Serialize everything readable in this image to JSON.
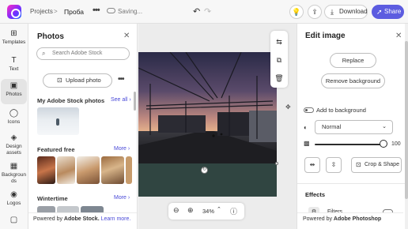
{
  "topbar": {
    "projects": "Projects",
    "separator": ">",
    "project_name": "Проба",
    "more": "•••",
    "saving": "Saving...",
    "undo": "↶",
    "redo": "↷",
    "lightbulb": "💡",
    "share_icon": "⇪",
    "download_icon": "⤓",
    "download_label": "Download",
    "share_label": "Share",
    "share_btn_icon": "➚"
  },
  "rail": [
    {
      "icon": "⊞",
      "label": "Templates",
      "name": "rail-templates"
    },
    {
      "icon": "T",
      "label": "Text",
      "name": "rail-text"
    },
    {
      "icon": "▣",
      "label": "Photos",
      "name": "rail-photos",
      "active": true
    },
    {
      "icon": "◯",
      "label": "Icons",
      "name": "rail-icons"
    },
    {
      "icon": "◈",
      "label": "Design assets",
      "name": "rail-design-assets"
    },
    {
      "icon": "▦",
      "label": "Backgrounds",
      "name": "rail-backgrounds"
    },
    {
      "icon": "◉",
      "label": "Logos",
      "name": "rail-logos"
    },
    {
      "icon": "▢",
      "label": "",
      "name": "rail-more"
    }
  ],
  "photos_panel": {
    "title": "Photos",
    "close": "✕",
    "search_icon": "⌕",
    "search_placeholder": "Search Adobe Stock",
    "upload_icon": "⊡",
    "upload_label": "Upload photo",
    "more": "•••",
    "stock_title": "My Adobe Stock photos",
    "see_all": "See all ›",
    "featured_title": "Featured free",
    "featured_more": "More ›",
    "winter_title": "Wintertime",
    "winter_more": "More ›",
    "footer_prefix": "Powered by ",
    "footer_brand": "Adobe Stock.",
    "footer_link": " Learn more."
  },
  "canvas": {
    "tools": [
      "⇆",
      "⧉",
      "🗑"
    ],
    "side_handle": "✥",
    "resize_handle": "↻",
    "zoom_out": "⊖",
    "zoom_in": "⊕",
    "zoom_value": "34%",
    "zoom_chevron": "⌃",
    "info": "ⓘ",
    "box_color": "#304541"
  },
  "edit_panel": {
    "title": "Edit image",
    "close": "✕",
    "replace": "Replace",
    "remove_bg": "Remove background",
    "add_to_bg": "Add to background",
    "blend_icon": "◐",
    "blend_value": "Normal",
    "blend_chevron": "⌄",
    "opacity_icon": "▩",
    "opacity_value": "100",
    "opacity_level": 1.0,
    "flip_h": "⇹",
    "flip_v": "⇳",
    "crop_icon": "⊡",
    "crop_label": "Crop & Shape",
    "effects": "Effects",
    "filters_icon": "⚙",
    "filters": "Filters",
    "footer_prefix": "Powered by ",
    "footer_brand": "Adobe Photoshop"
  },
  "colors": {
    "accent": "#5c5ce0",
    "link": "#4a4ad8"
  }
}
